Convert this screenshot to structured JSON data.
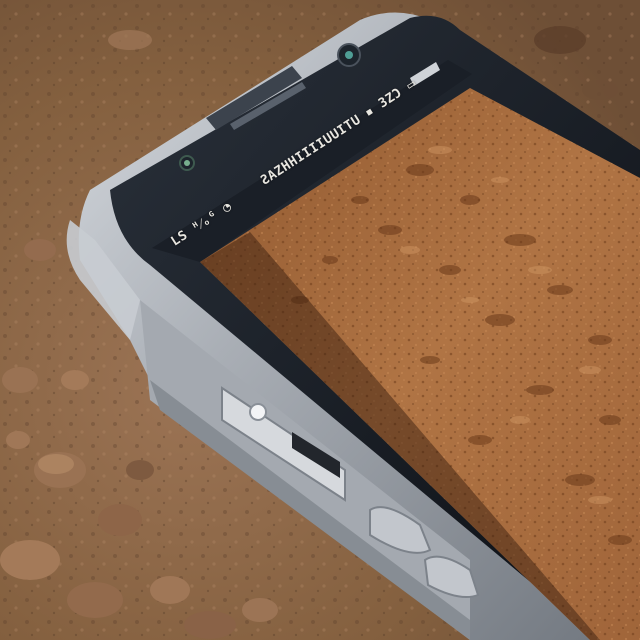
{
  "scene": {
    "description_tags": [
      "smartphone",
      "sand-texture-screen",
      "rocky-soil-ground"
    ],
    "colors": {
      "ground": "#8a6549",
      "ground_dark": "#5c3f2b",
      "ground_light": "#b38a66",
      "phone_frame": "#b9bec4",
      "phone_frame_dark": "#6f757c",
      "phone_bezel": "#14181e",
      "screen_sand": "#a8683a",
      "screen_sand_dark": "#7a4624",
      "status_bar": "#1a1f27"
    }
  },
  "phone": {
    "status_bar": {
      "left_text": "LS ᴴ⁄ₒᴳ ◔",
      "center_text": "ƧAZHHIIIIUUITU",
      "right_text": "▪ ЗZƆ ▭"
    }
  }
}
